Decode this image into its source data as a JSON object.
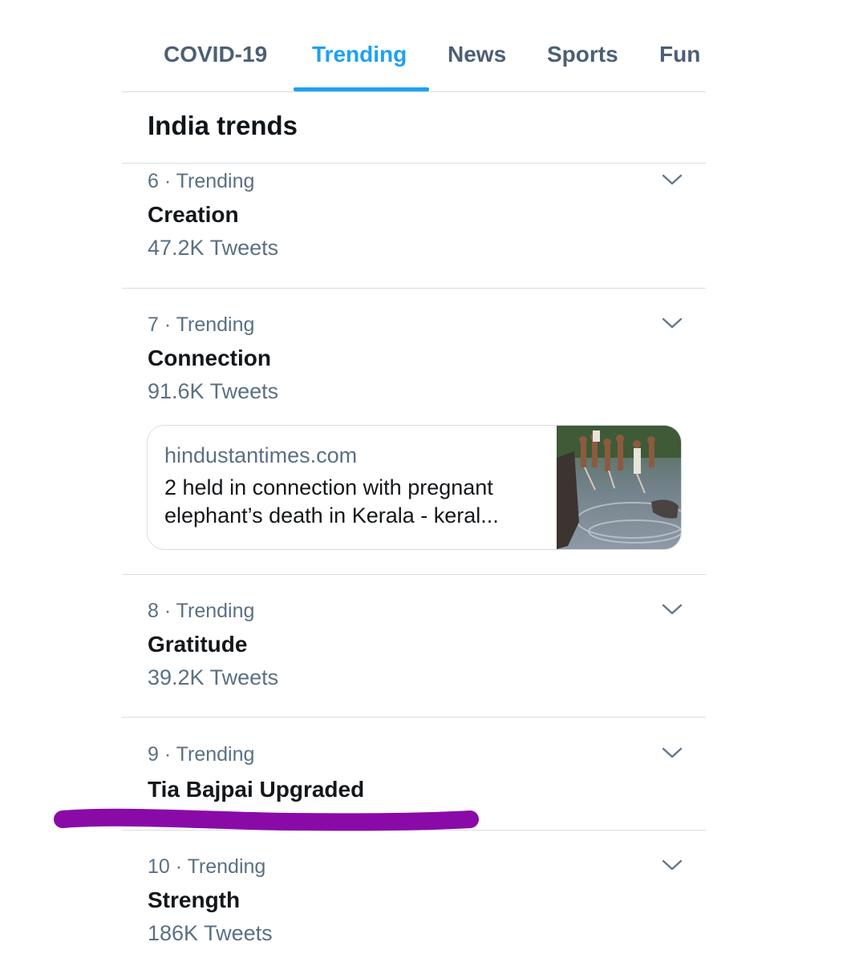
{
  "tabs": [
    {
      "label": "COVID-19",
      "active": false
    },
    {
      "label": "Trending",
      "active": true
    },
    {
      "label": "News",
      "active": false
    },
    {
      "label": "Sports",
      "active": false
    },
    {
      "label": "Fun",
      "active": false
    }
  ],
  "section_title": "India trends",
  "trends": [
    {
      "meta": "6 · Trending",
      "name": "Creation",
      "count": "47.2K Tweets"
    },
    {
      "meta": "7 · Trending",
      "name": "Connection",
      "count": "91.6K Tweets"
    },
    {
      "meta": "8 · Trending",
      "name": "Gratitude",
      "count": "39.2K Tweets"
    },
    {
      "meta": "9 · Trending",
      "name": "Tia Bajpai Upgraded"
    },
    {
      "meta": "10 · Trending",
      "name": "Strength",
      "count": "186K Tweets"
    }
  ],
  "link_card": {
    "source": "hindustantimes.com",
    "title": "2 held in connection with pregnant elephant’s death in Kerala - keral..."
  },
  "icons": {
    "trend_menu": "chevron-down-icon",
    "card_image": "news-thumbnail"
  },
  "colors": {
    "accent": "#1da1f2",
    "tab_text": "#4d5f74",
    "secondary_text": "#5b7083",
    "highlight_mark": "#8a0aa8"
  }
}
